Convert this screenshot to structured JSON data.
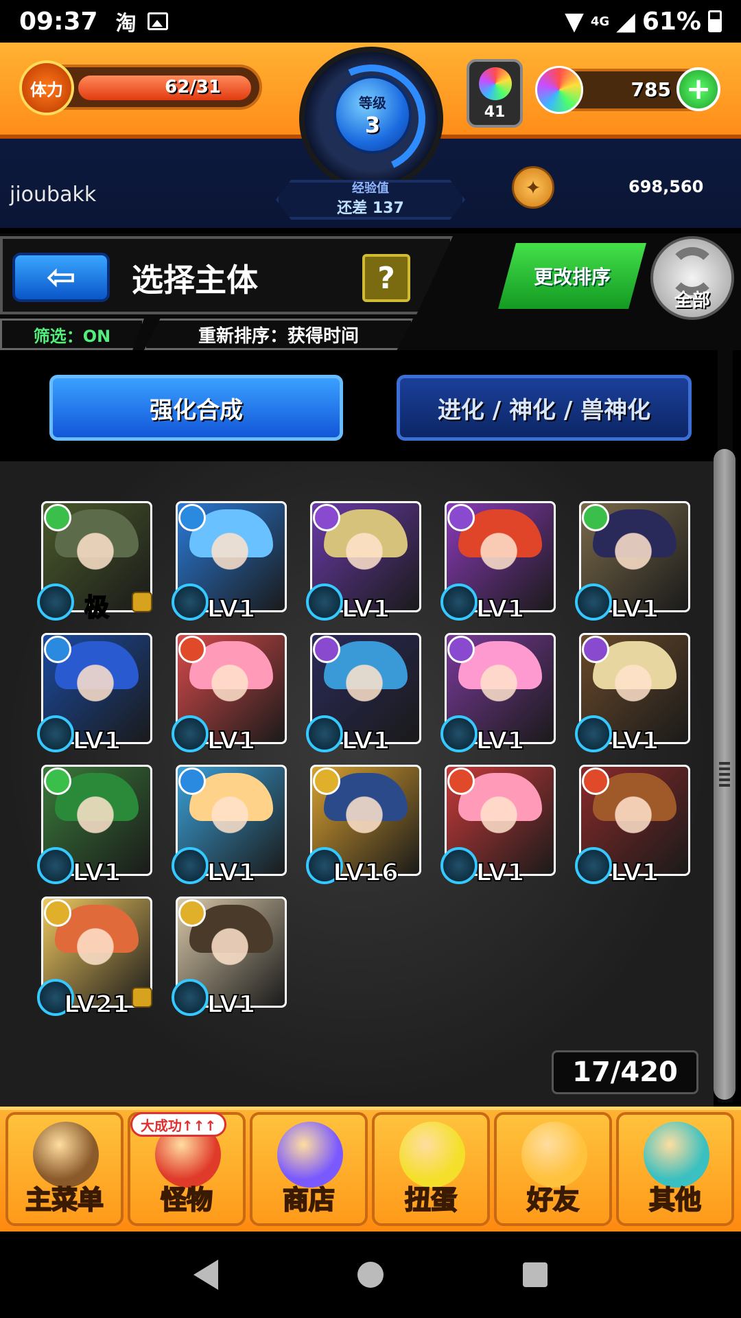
{
  "status_bar": {
    "time": "09:37",
    "taobao_icon": "淘",
    "network": "4G",
    "battery": "61%"
  },
  "header": {
    "stamina_label": "体力",
    "stamina_value": "62/31",
    "level_label": "等级",
    "level_value": "3",
    "exp_label": "经验值",
    "exp_remaining": "还差 137",
    "gem_count": "41",
    "orb_count": "785",
    "username": "jioubakk",
    "coins": "698,560"
  },
  "title_bar": {
    "title": "选择主体",
    "help": "?",
    "filter": "筛选：ON",
    "sort": "重新排序：获得时间",
    "change_sort": "更改排序",
    "all": "全部"
  },
  "mode_buttons": {
    "power_up": "强化合成",
    "evolve": "进化 / 神化 / 兽神化"
  },
  "monsters": [
    {
      "level": "",
      "special": "极",
      "element": "wood",
      "locked": true,
      "bg": "#4a5a2a",
      "hair": "#5c6b4a"
    },
    {
      "level": "LV1",
      "element": "water",
      "locked": false,
      "bg": "#2a7ad8",
      "hair": "#6ac1ff"
    },
    {
      "level": "LV1",
      "element": "dark",
      "locked": false,
      "bg": "#6a3aa8",
      "hair": "#d6c27a"
    },
    {
      "level": "LV1",
      "element": "dark",
      "locked": false,
      "bg": "#8a3ab8",
      "hair": "#e0452a"
    },
    {
      "level": "LV1",
      "element": "wood",
      "locked": false,
      "bg": "#7a6a4a",
      "hair": "#2a2a5a"
    },
    {
      "level": "LV1",
      "element": "water",
      "locked": false,
      "bg": "#1a4aa0",
      "hair": "#2a5ad0"
    },
    {
      "level": "LV1",
      "element": "fire",
      "locked": false,
      "bg": "#d84a4a",
      "hair": "#ff9ab8"
    },
    {
      "level": "LV1",
      "element": "dark",
      "locked": false,
      "bg": "#2a2a5a",
      "hair": "#3a9ad8"
    },
    {
      "level": "LV1",
      "element": "dark",
      "locked": false,
      "bg": "#7a3a9a",
      "hair": "#ff9ad0"
    },
    {
      "level": "LV1",
      "element": "dark",
      "locked": false,
      "bg": "#6a4a2a",
      "hair": "#e8d6a0"
    },
    {
      "level": "LV1",
      "element": "wood",
      "locked": false,
      "bg": "#3a7a3a",
      "hair": "#2a8a3a"
    },
    {
      "level": "LV1",
      "element": "water",
      "locked": false,
      "bg": "#3aa0d8",
      "hair": "#ffd28a"
    },
    {
      "level": "LV16",
      "element": "light",
      "locked": false,
      "bg": "#d8a030",
      "hair": "#2a4a8a"
    },
    {
      "level": "LV1",
      "element": "fire",
      "locked": false,
      "bg": "#c83a3a",
      "hair": "#ff9ab8"
    },
    {
      "level": "LV1",
      "element": "fire",
      "locked": false,
      "bg": "#8a2a2a",
      "hair": "#a05a2a"
    },
    {
      "level": "LV21",
      "element": "light",
      "locked": true,
      "bg": "#f0c860",
      "hair": "#e06a3a"
    },
    {
      "level": "LV1",
      "element": "light",
      "locked": false,
      "bg": "#d8c8a8",
      "hair": "#4a3a2a"
    }
  ],
  "box_count": "17/420",
  "bottom_nav": [
    {
      "label": "主菜单",
      "icon": "gate-icon",
      "color": "#8a5a2a"
    },
    {
      "label": "怪物",
      "icon": "monster-icon",
      "color": "#e03a2a"
    },
    {
      "label": "商店",
      "icon": "orb-icon",
      "color": "#7a5aff"
    },
    {
      "label": "扭蛋",
      "icon": "egg-icon",
      "color": "#f4e02a"
    },
    {
      "label": "好友",
      "icon": "friends-icon",
      "color": "#ffc23d"
    },
    {
      "label": "其他",
      "icon": "other-icon",
      "color": "#3ac0c0"
    }
  ],
  "nav_badge": "大成功↑↑↑",
  "element_colors": {
    "wood": "#3ac04a",
    "water": "#2a8ae0",
    "dark": "#8a4ad0",
    "fire": "#e04a2a",
    "light": "#e0b02a"
  }
}
